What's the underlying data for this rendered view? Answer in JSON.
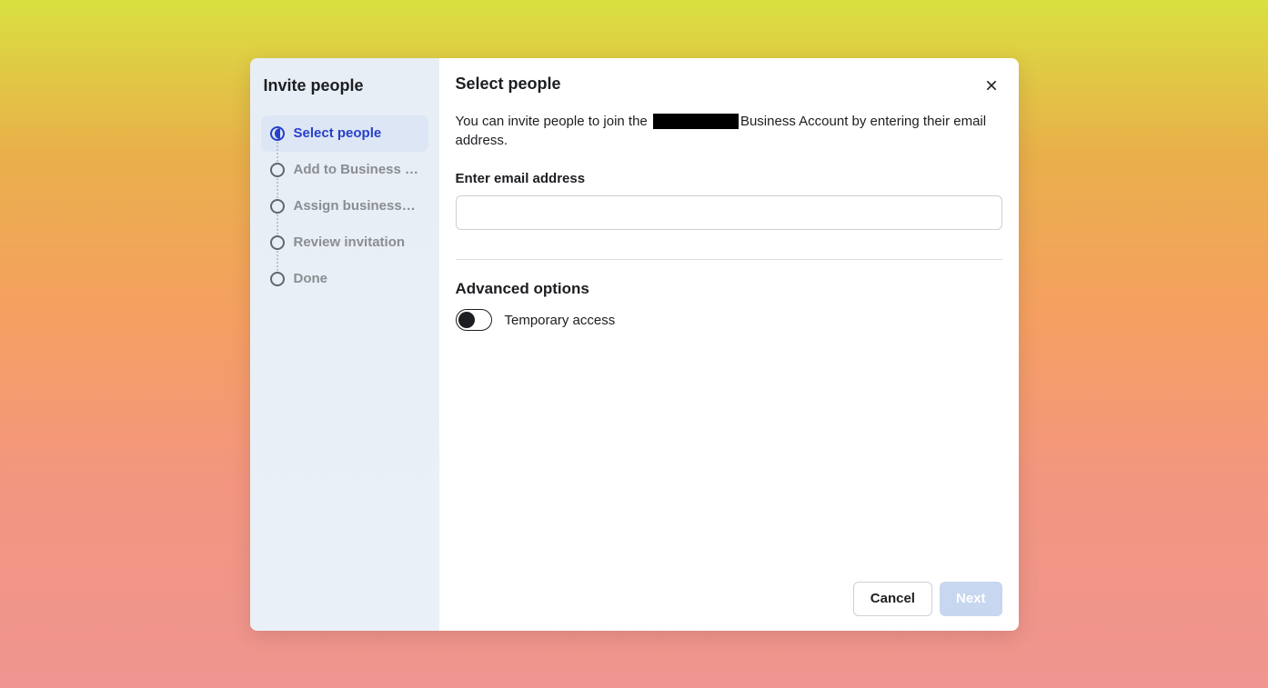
{
  "sidebar": {
    "title": "Invite people",
    "steps": [
      {
        "label": "Select people",
        "status": "active"
      },
      {
        "label": "Add to Business …",
        "status": "pending"
      },
      {
        "label": "Assign business a…",
        "status": "pending"
      },
      {
        "label": "Review invitation",
        "status": "pending"
      },
      {
        "label": "Done",
        "status": "pending"
      }
    ]
  },
  "main": {
    "title": "Select people",
    "description_prefix": "You can invite people to join the ",
    "description_suffix": "Business Account by entering their email address.",
    "redacted_name": "[redacted]",
    "field_label": "Enter email address",
    "email_value": "",
    "advanced": {
      "title": "Advanced options",
      "temporary_label": "Temporary access",
      "temporary_enabled": false
    }
  },
  "footer": {
    "cancel_label": "Cancel",
    "next_label": "Next",
    "next_enabled": false
  }
}
